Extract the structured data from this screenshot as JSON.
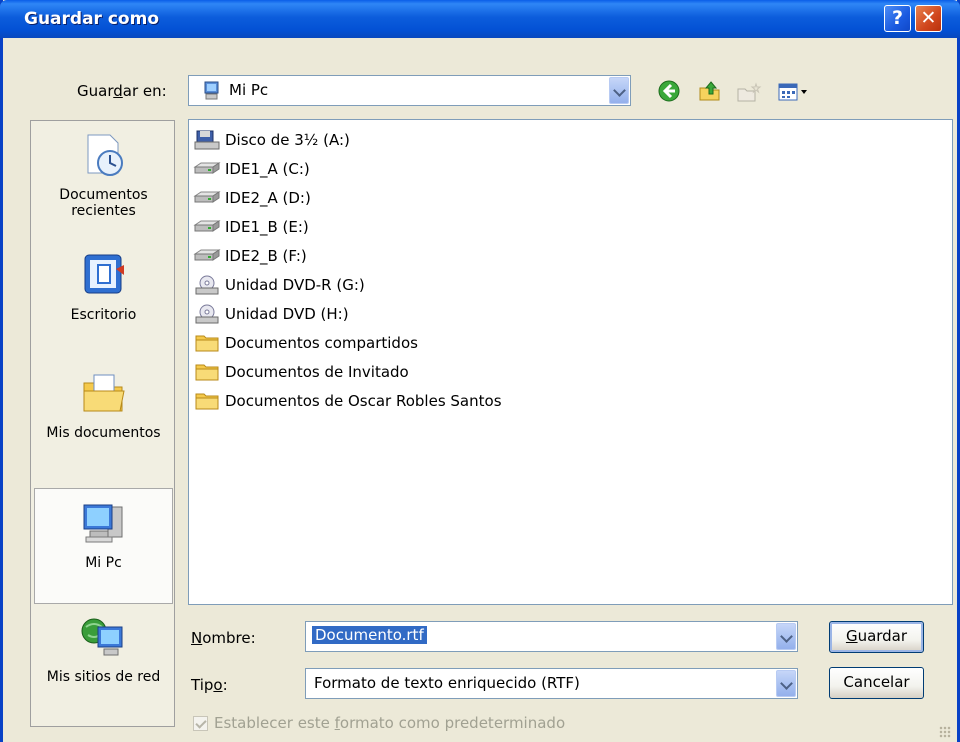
{
  "window": {
    "title": "Guardar como"
  },
  "titlebar": {
    "help_label": "?",
    "close_label": "✕"
  },
  "save_in": {
    "label_pre": "Guar",
    "label_u": "d",
    "label_post": "ar en:",
    "value": "Mi Pc"
  },
  "places": [
    {
      "label": "Documentos recientes",
      "icon": "recent-documents-icon"
    },
    {
      "label": "Escritorio",
      "icon": "desktop-icon"
    },
    {
      "label": "Mis documentos",
      "icon": "my-documents-icon"
    },
    {
      "label": "Mi Pc",
      "icon": "my-computer-icon",
      "selected": true
    },
    {
      "label": "Mis sitios de red",
      "icon": "network-places-icon"
    }
  ],
  "files": [
    {
      "name": "Disco de 3½ (A:)",
      "icon": "floppy-drive-icon"
    },
    {
      "name": "IDE1_A (C:)",
      "icon": "hard-drive-icon"
    },
    {
      "name": "IDE2_A (D:)",
      "icon": "hard-drive-icon"
    },
    {
      "name": "IDE1_B (E:)",
      "icon": "hard-drive-icon"
    },
    {
      "name": "IDE2_B (F:)",
      "icon": "hard-drive-icon"
    },
    {
      "name": "Unidad DVD-R (G:)",
      "icon": "dvd-drive-icon"
    },
    {
      "name": "Unidad DVD (H:)",
      "icon": "dvd-drive-icon"
    },
    {
      "name": "Documentos compartidos",
      "icon": "folder-icon"
    },
    {
      "name": "Documentos de Invitado",
      "icon": "folder-icon"
    },
    {
      "name": "Documentos de Oscar Robles Santos",
      "icon": "folder-icon"
    }
  ],
  "filename": {
    "label_u": "N",
    "label_post": "ombre:",
    "value": "Documento.rtf"
  },
  "filetype": {
    "label_pre": "Tip",
    "label_u": "o",
    "label_post": ":",
    "value": "Formato de texto enriquecido (RTF)"
  },
  "buttons": {
    "save_u": "G",
    "save_post": "uardar",
    "cancel": "Cancelar"
  },
  "default_format": {
    "label_pre": "Establecer este ",
    "label_u": "f",
    "label_post": "ormato como predeterminado",
    "checked": true
  }
}
